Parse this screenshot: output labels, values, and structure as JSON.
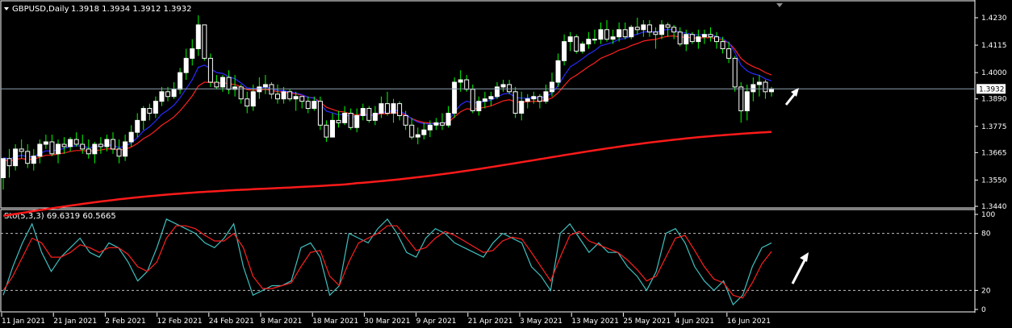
{
  "header": {
    "symbol_label": "GBPUSD,Daily",
    "ohlc_label": "1.3918 1.3934 1.3912 1.3932"
  },
  "price_panel": {
    "y_ticks": [
      "1.4230",
      "1.4115",
      "1.4000",
      "1.3890",
      "1.3775",
      "1.3665",
      "1.3550",
      "1.3440"
    ],
    "current_price": "1.3932",
    "colors": {
      "bull": "#ffffff",
      "bear": "#ffffff",
      "wick": "#00ff00",
      "ma_fast": "#2a2aff",
      "ma_mid": "#ff2020",
      "ma_slow": "#ff1a1a",
      "price_line": "#8ea0b0"
    }
  },
  "indicator_panel": {
    "label": "Sto(5,3,3) 69.6319 60.5665",
    "y_ticks": [
      "100",
      "80",
      "20",
      "0"
    ],
    "colors": {
      "main": "#40c0c0",
      "signal": "#ff2020",
      "levels": "#c0c0c0"
    }
  },
  "x_axis": {
    "labels": [
      "11 Jan 2021",
      "21 Jan 2021",
      "2 Feb 2021",
      "12 Feb 2021",
      "24 Feb 2021",
      "8 Mar 2021",
      "18 Mar 2021",
      "30 Mar 2021",
      "9 Apr 2021",
      "21 Apr 2021",
      "3 May 2021",
      "13 May 2021",
      "25 May 2021",
      "4 Jun 2021",
      "16 Jun 2021"
    ]
  },
  "annotations": {
    "arrow_color": "#ffffff"
  },
  "chart_data": [
    {
      "type": "candlestick",
      "title": "GBPUSD,Daily",
      "ylim": [
        1.344,
        1.426
      ],
      "open": [
        1.356,
        1.364,
        1.361,
        1.368,
        1.367,
        1.362,
        1.365,
        1.37,
        1.371,
        1.366,
        1.37,
        1.369,
        1.372,
        1.37,
        1.368,
        1.366,
        1.37,
        1.369,
        1.372,
        1.368,
        1.365,
        1.371,
        1.375,
        1.38,
        1.385,
        1.383,
        1.388,
        1.392,
        1.39,
        1.393,
        1.4,
        1.406,
        1.41,
        1.42,
        1.406,
        1.396,
        1.394,
        1.398,
        1.393,
        1.394,
        1.389,
        1.386,
        1.392,
        1.394,
        1.395,
        1.391,
        1.389,
        1.392,
        1.389,
        1.39,
        1.388,
        1.385,
        1.388,
        1.378,
        1.373,
        1.38,
        1.379,
        1.383,
        1.377,
        1.382,
        1.385,
        1.38,
        1.383,
        1.387,
        1.383,
        1.387,
        1.382,
        1.378,
        1.373,
        1.374,
        1.376,
        1.378,
        1.379,
        1.378,
        1.383,
        1.396,
        1.397,
        1.393,
        1.384,
        1.388,
        1.389,
        1.39,
        1.394,
        1.395,
        1.392,
        1.383,
        1.388,
        1.389,
        1.39,
        1.388,
        1.392,
        1.396,
        1.405,
        1.413,
        1.415,
        1.409,
        1.412,
        1.414,
        1.414,
        1.418,
        1.414,
        1.415,
        1.418,
        1.415,
        1.419,
        1.418,
        1.42,
        1.417,
        1.416,
        1.42,
        1.419,
        1.417,
        1.412,
        1.416,
        1.413,
        1.415,
        1.416,
        1.415,
        1.413,
        1.41,
        1.406,
        1.394,
        1.384,
        1.392,
        1.395,
        1.396,
        1.392
      ],
      "high": [
        1.36,
        1.368,
        1.37,
        1.372,
        1.37,
        1.368,
        1.372,
        1.374,
        1.374,
        1.372,
        1.373,
        1.373,
        1.375,
        1.374,
        1.372,
        1.371,
        1.373,
        1.374,
        1.375,
        1.372,
        1.374,
        1.378,
        1.383,
        1.386,
        1.387,
        1.39,
        1.394,
        1.394,
        1.396,
        1.402,
        1.41,
        1.414,
        1.424,
        1.42,
        1.408,
        1.399,
        1.399,
        1.401,
        1.399,
        1.395,
        1.392,
        1.395,
        1.398,
        1.399,
        1.396,
        1.395,
        1.394,
        1.393,
        1.392,
        1.39,
        1.39,
        1.39,
        1.39,
        1.38,
        1.383,
        1.384,
        1.386,
        1.385,
        1.385,
        1.387,
        1.386,
        1.386,
        1.39,
        1.392,
        1.389,
        1.388,
        1.384,
        1.381,
        1.377,
        1.379,
        1.38,
        1.381,
        1.383,
        1.386,
        1.398,
        1.401,
        1.399,
        1.395,
        1.39,
        1.392,
        1.392,
        1.396,
        1.397,
        1.397,
        1.394,
        1.392,
        1.391,
        1.392,
        1.391,
        1.395,
        1.4,
        1.408,
        1.416,
        1.417,
        1.416,
        1.413,
        1.417,
        1.418,
        1.421,
        1.422,
        1.418,
        1.421,
        1.421,
        1.42,
        1.423,
        1.422,
        1.422,
        1.419,
        1.422,
        1.421,
        1.42,
        1.419,
        1.418,
        1.417,
        1.418,
        1.418,
        1.419,
        1.417,
        1.415,
        1.413,
        1.407,
        1.396,
        1.395,
        1.398,
        1.399,
        1.397,
        1.394
      ],
      "low": [
        1.351,
        1.356,
        1.359,
        1.364,
        1.36,
        1.359,
        1.362,
        1.368,
        1.365,
        1.362,
        1.366,
        1.367,
        1.369,
        1.366,
        1.364,
        1.362,
        1.366,
        1.367,
        1.366,
        1.362,
        1.363,
        1.369,
        1.373,
        1.376,
        1.38,
        1.381,
        1.386,
        1.388,
        1.389,
        1.391,
        1.397,
        1.403,
        1.407,
        1.405,
        1.394,
        1.393,
        1.392,
        1.391,
        1.39,
        1.387,
        1.383,
        1.384,
        1.389,
        1.391,
        1.389,
        1.387,
        1.387,
        1.388,
        1.384,
        1.385,
        1.383,
        1.384,
        1.376,
        1.371,
        1.373,
        1.377,
        1.378,
        1.376,
        1.375,
        1.38,
        1.379,
        1.378,
        1.381,
        1.382,
        1.379,
        1.38,
        1.376,
        1.372,
        1.37,
        1.372,
        1.373,
        1.376,
        1.376,
        1.377,
        1.381,
        1.392,
        1.392,
        1.383,
        1.382,
        1.385,
        1.386,
        1.389,
        1.392,
        1.391,
        1.381,
        1.38,
        1.385,
        1.387,
        1.385,
        1.387,
        1.39,
        1.394,
        1.403,
        1.409,
        1.408,
        1.408,
        1.41,
        1.412,
        1.412,
        1.413,
        1.412,
        1.413,
        1.414,
        1.414,
        1.416,
        1.415,
        1.415,
        1.41,
        1.414,
        1.415,
        1.414,
        1.411,
        1.409,
        1.412,
        1.41,
        1.412,
        1.413,
        1.41,
        1.408,
        1.404,
        1.392,
        1.379,
        1.38,
        1.388,
        1.39,
        1.389,
        1.39
      ],
      "close": [
        1.364,
        1.361,
        1.368,
        1.367,
        1.362,
        1.365,
        1.37,
        1.371,
        1.366,
        1.37,
        1.369,
        1.372,
        1.37,
        1.368,
        1.366,
        1.37,
        1.369,
        1.372,
        1.368,
        1.365,
        1.371,
        1.375,
        1.38,
        1.385,
        1.383,
        1.388,
        1.392,
        1.39,
        1.393,
        1.4,
        1.406,
        1.41,
        1.42,
        1.406,
        1.396,
        1.394,
        1.398,
        1.393,
        1.394,
        1.389,
        1.386,
        1.392,
        1.394,
        1.395,
        1.391,
        1.389,
        1.392,
        1.389,
        1.39,
        1.388,
        1.385,
        1.388,
        1.378,
        1.373,
        1.38,
        1.379,
        1.383,
        1.377,
        1.382,
        1.385,
        1.38,
        1.383,
        1.387,
        1.383,
        1.387,
        1.382,
        1.378,
        1.373,
        1.374,
        1.376,
        1.378,
        1.379,
        1.378,
        1.383,
        1.396,
        1.397,
        1.393,
        1.384,
        1.388,
        1.389,
        1.39,
        1.394,
        1.395,
        1.392,
        1.383,
        1.388,
        1.389,
        1.39,
        1.388,
        1.392,
        1.396,
        1.405,
        1.413,
        1.415,
        1.409,
        1.412,
        1.414,
        1.414,
        1.418,
        1.414,
        1.415,
        1.418,
        1.415,
        1.419,
        1.418,
        1.42,
        1.417,
        1.416,
        1.42,
        1.419,
        1.417,
        1.412,
        1.416,
        1.413,
        1.415,
        1.416,
        1.415,
        1.413,
        1.41,
        1.406,
        1.394,
        1.384,
        1.392,
        1.395,
        1.396,
        1.392,
        1.3932
      ]
    },
    {
      "type": "line",
      "title": "Sto(5,3,3) 69.6319 60.5665",
      "ylim": [
        0,
        100
      ],
      "series": [
        {
          "name": "main",
          "values": [
            15,
            45,
            70,
            90,
            60,
            40,
            55,
            65,
            75,
            60,
            55,
            70,
            65,
            50,
            30,
            40,
            65,
            95,
            90,
            85,
            80,
            70,
            65,
            75,
            90,
            45,
            15,
            20,
            25,
            25,
            30,
            65,
            70,
            55,
            15,
            25,
            80,
            75,
            70,
            85,
            95,
            80,
            60,
            55,
            75,
            85,
            80,
            70,
            65,
            60,
            55,
            70,
            80,
            75,
            70,
            45,
            35,
            20,
            80,
            90,
            75,
            60,
            70,
            60,
            60,
            45,
            35,
            20,
            40,
            80,
            85,
            70,
            45,
            30,
            20,
            30,
            5,
            15,
            45,
            65,
            70
          ]
        },
        {
          "name": "signal",
          "values": [
            20,
            35,
            55,
            75,
            70,
            55,
            55,
            60,
            68,
            65,
            60,
            65,
            65,
            58,
            45,
            40,
            50,
            75,
            88,
            88,
            85,
            78,
            72,
            72,
            80,
            65,
            35,
            22,
            22,
            25,
            28,
            45,
            60,
            62,
            35,
            25,
            50,
            70,
            75,
            80,
            88,
            88,
            75,
            62,
            65,
            75,
            82,
            78,
            72,
            66,
            60,
            62,
            72,
            76,
            74,
            60,
            45,
            30,
            55,
            78,
            82,
            72,
            68,
            64,
            60,
            52,
            42,
            30,
            35,
            55,
            75,
            78,
            62,
            45,
            32,
            28,
            15,
            12,
            28,
            48,
            61
          ]
        }
      ],
      "levels": [
        80,
        20
      ]
    }
  ]
}
